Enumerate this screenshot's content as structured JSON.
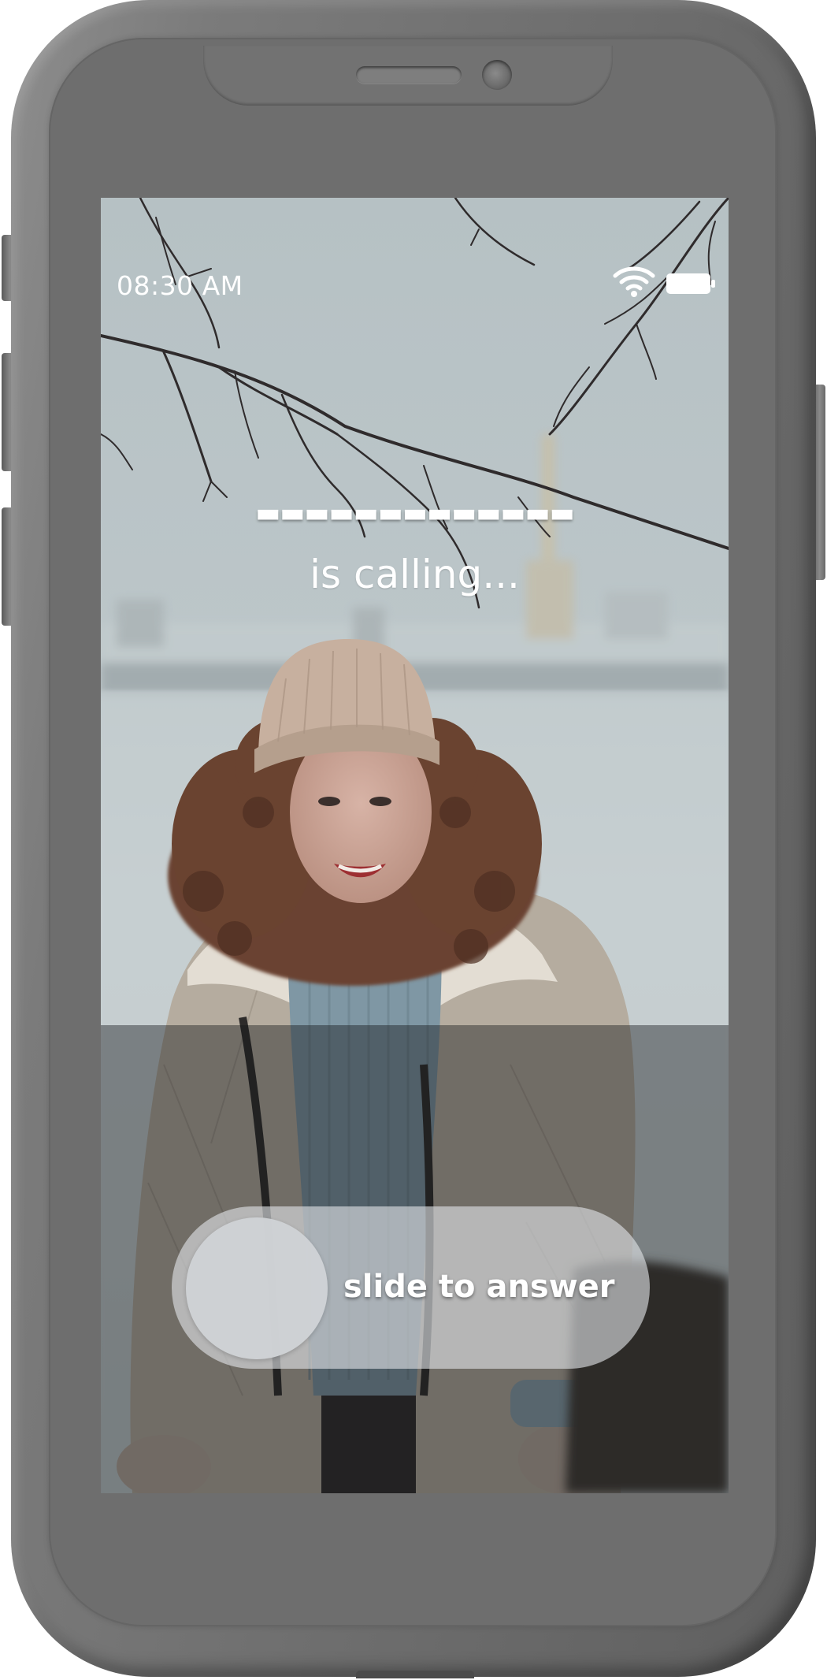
{
  "status_bar": {
    "time": "08:30 AM",
    "wifi_icon": "wifi-icon",
    "battery_icon": "battery-full-icon"
  },
  "call": {
    "caller_name": "▬▬▬▬▬▬▬▬▬▬▬▬▬",
    "status_text": "is calling..."
  },
  "answer_slider": {
    "label": "slide to answer",
    "position": 0
  },
  "colors": {
    "phone_body": "#6e6e6e",
    "screen_sky": "#b7c3c6",
    "text": "#ffffff"
  }
}
